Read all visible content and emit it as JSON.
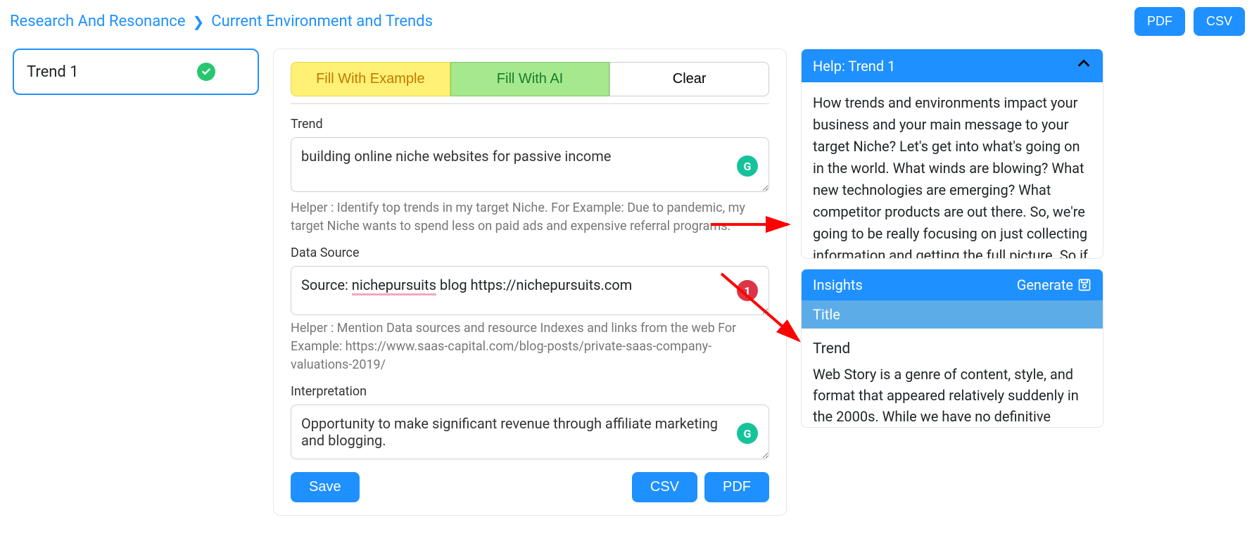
{
  "breadcrumb": {
    "parent": "Research And Resonance",
    "current": "Current Environment and Trends"
  },
  "top_actions": {
    "pdf": "PDF",
    "csv": "CSV"
  },
  "left_tabs": {
    "items": [
      {
        "label": "Trend 1",
        "status": "complete"
      }
    ]
  },
  "center": {
    "buttons": {
      "fill_example": "Fill With Example",
      "fill_ai": "Fill With AI",
      "clear": "Clear"
    },
    "fields": {
      "trend": {
        "label": "Trend",
        "value": "building online niche websites for passive income",
        "helper": "Helper : Identify top trends in my target Niche. For Example: Due to pandemic, my target Niche wants to spend less on paid ads and expensive referral programs."
      },
      "data_source": {
        "label": "Data Source",
        "value_prefix": "Source: ",
        "value_underlined": "nichepursuits",
        "value_suffix": " blog https://nichepursuits.com",
        "badge_count": "1",
        "helper": "Helper : Mention Data sources and resource Indexes and links from the web For Example: https://www.saas-capital.com/blog-posts/private-saas-company-valuations-2019/"
      },
      "interpretation": {
        "label": "Interpretation",
        "value": "Opportunity to make significant revenue through affiliate marketing and blogging."
      }
    },
    "bottom": {
      "save": "Save",
      "csv": "CSV",
      "pdf": "PDF"
    }
  },
  "right": {
    "help": {
      "title": "Help: Trend 1",
      "body": "How trends and environments impact your business and your main message to your target Niche? Let's get into what's going on in the world. What winds are blowing? What new technologies are emerging? What competitor products are out there. So, we're going to be really focusing on just collecting information and getting the full picture. So if"
    },
    "insights": {
      "title": "Insights",
      "generate": "Generate",
      "subheader": "Title",
      "body_heading": "Trend",
      "body_text": "Web Story is a genre of content, style, and format that appeared relatively suddenly in the 2000s. While we have no definitive answer on the origin of the"
    }
  },
  "icons": {
    "grammarly": "G"
  }
}
